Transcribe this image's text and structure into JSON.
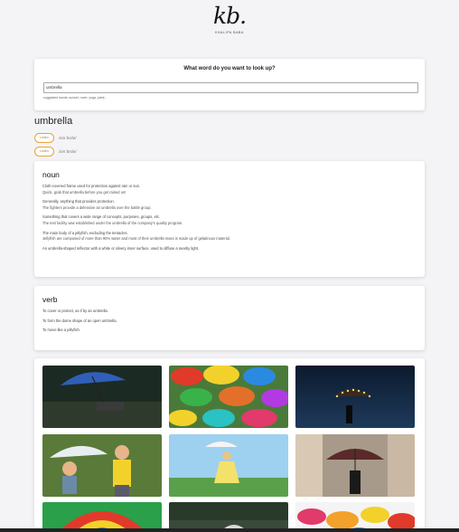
{
  "logo": {
    "mark": "kb.",
    "subtitle": "KHALIPA BABA"
  },
  "search": {
    "question": "What word do you want to look up?",
    "value": "umbrella",
    "suggestions": "suggested words: sunset, rover, yoga, plant..."
  },
  "word": {
    "title": "umbrella",
    "pronunciations": [
      {
        "label": "Listen",
        "text": "/ʌmˈbrɛlə/"
      },
      {
        "label": "Listen",
        "text": "/ʌmˈbrɛlə/"
      }
    ]
  },
  "meanings": [
    {
      "part_of_speech": "noun",
      "definitions": [
        {
          "def": "Cloth-covered frame used for protection against rain or sun.",
          "example": "Quick, grab that umbrella before you get rained on!"
        },
        {
          "def": "Generally, anything that provides protection.",
          "example": "The fighters provide a defensive air umbrella over the battle group."
        },
        {
          "def": "Something that covers a wide range of concepts, purposes, groups, etc.",
          "example": "The test facility was established under the umbrella of the company's quality program."
        },
        {
          "def": "The main body of a jellyfish, excluding the tentacles.",
          "example": "Jellyfish are composed of more than 90% water and most of their umbrella mass is made up of gelatinous material."
        },
        {
          "def": "An umbrella-shaped reflector with a white or silvery inner surface, used to diffuse a nearby light.",
          "example": ""
        }
      ]
    },
    {
      "part_of_speech": "verb",
      "definitions": [
        {
          "def": "To cover or protect, as if by an umbrella.",
          "example": ""
        },
        {
          "def": "To form the dome shape of an open umbrella.",
          "example": ""
        },
        {
          "def": "To move like a jellyfish.",
          "example": ""
        }
      ]
    }
  ],
  "colors": {
    "accent": "#e6a23c",
    "background": "#f4f4f7"
  }
}
